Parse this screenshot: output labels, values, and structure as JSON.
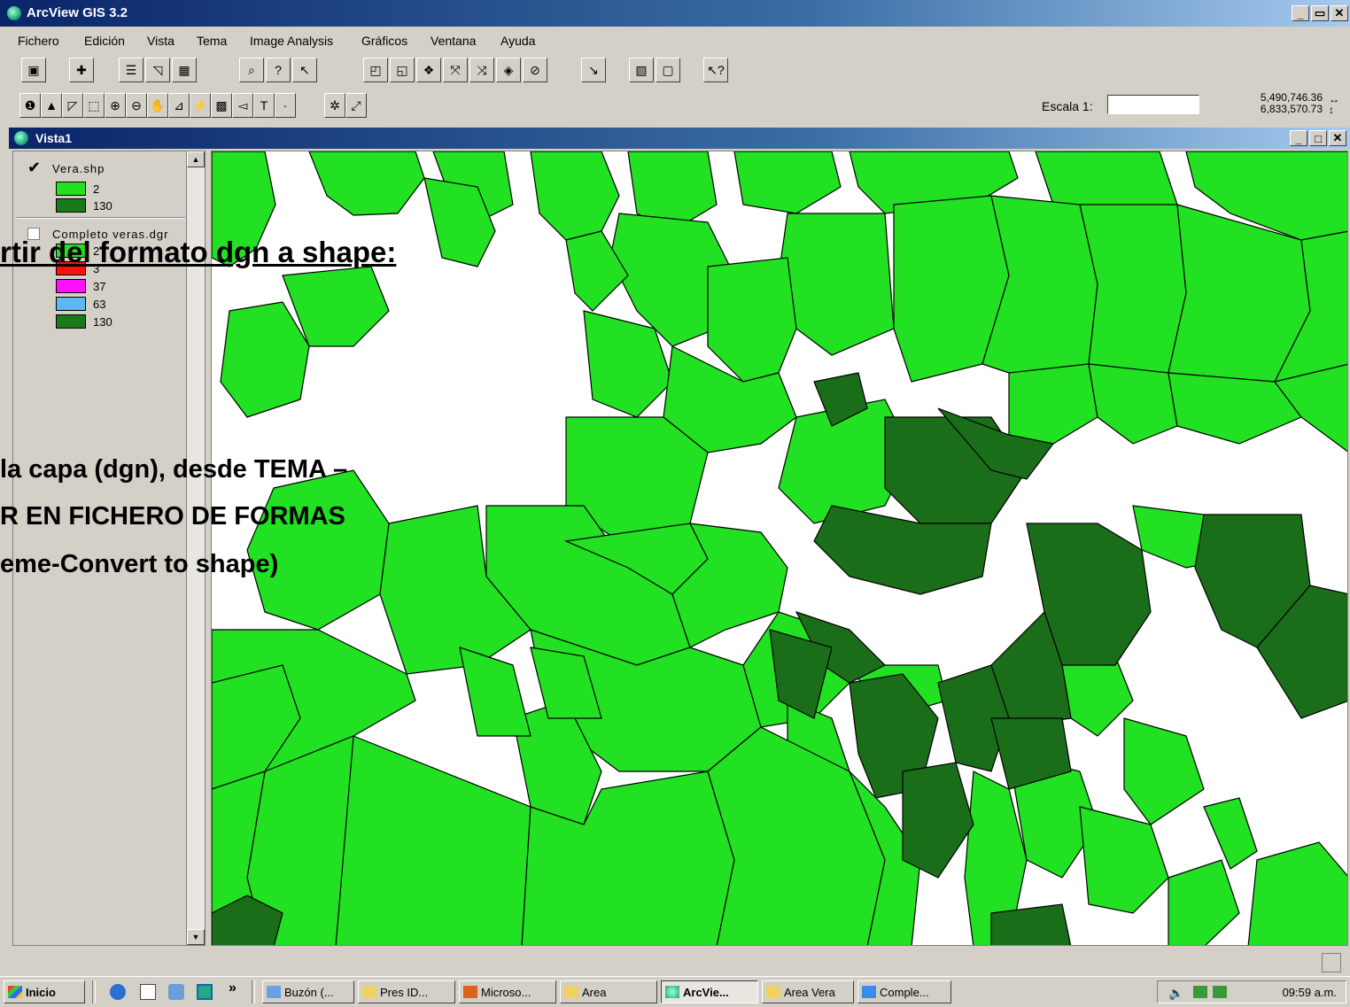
{
  "window": {
    "title": "ArcView GIS 3.2",
    "controls": [
      "_",
      "ᴮ",
      "x"
    ]
  },
  "menu": [
    "Fichero",
    "Edición",
    "Vista",
    "Tema",
    "Image Analysis",
    "Gráficos",
    "Ventana",
    "Ayuda"
  ],
  "toolbar": {
    "scale_label": "Escala 1:",
    "scale_value": "",
    "coord_x": "5,490,746.36",
    "coord_y": "6,833,570.73"
  },
  "view": {
    "title": "Vista1"
  },
  "legend": {
    "themes": [
      {
        "name": "Vera.shp",
        "checked": true,
        "classes": [
          {
            "label": "2",
            "color": "#22e022"
          },
          {
            "label": "130",
            "color": "#1a7a1a"
          }
        ]
      },
      {
        "name": "Completo veras.dgr",
        "checked": false,
        "classes": [
          {
            "label": "2",
            "color": "#22e022"
          },
          {
            "label": "3",
            "color": "#ff1010"
          },
          {
            "label": "37",
            "color": "#ff10ff"
          },
          {
            "label": "63",
            "color": "#5bb8f0"
          },
          {
            "label": "130",
            "color": "#1a7a1a"
          }
        ]
      }
    ]
  },
  "overlay_text": {
    "heading": "rtir del formato dgn a shape:",
    "line1": "la capa (dgn), desde TEMA –",
    "line2": "R   EN FICHERO DE FORMAS",
    "line3": "eme-Convert to shape)"
  },
  "colors": {
    "light_green": "#22e022",
    "dark_green": "#1a6e1a",
    "title_blue": "#0a246a"
  },
  "taskbar": {
    "start": "Inicio",
    "more": "»",
    "buttons": [
      "Buzón (...",
      "Pres ID...",
      "Microso...",
      "Area",
      "ArcVie...",
      "Area Vera",
      "Comple..."
    ],
    "clock": "09:59 a.m."
  }
}
